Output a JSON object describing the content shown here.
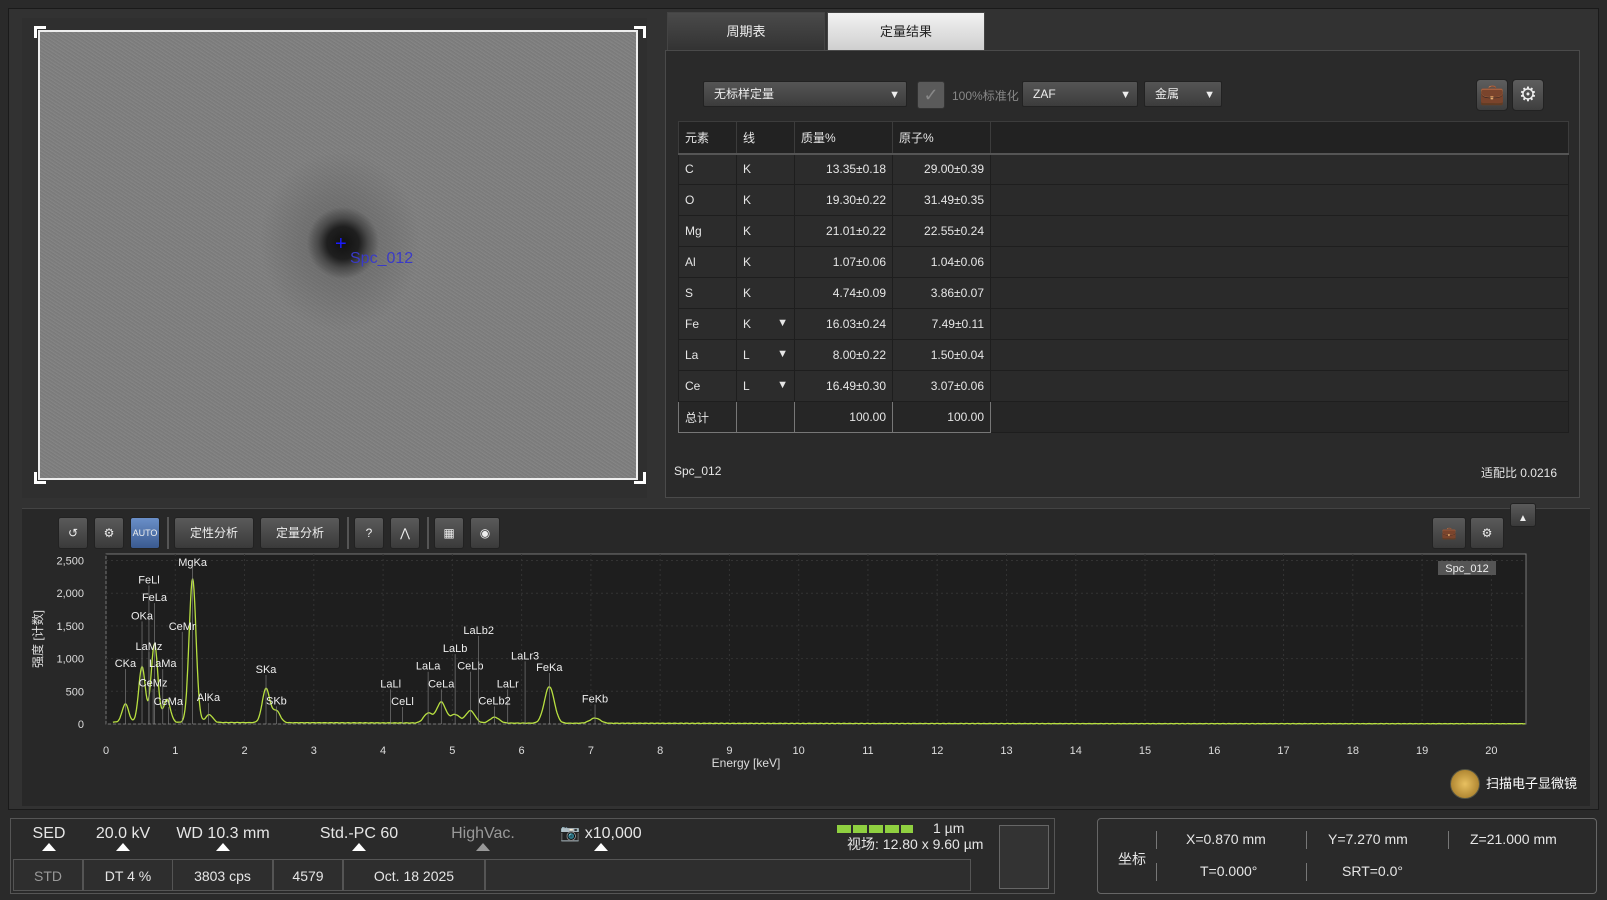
{
  "image": {
    "spot_label": "Spc_012"
  },
  "tabs": [
    "周期表",
    "定量结果"
  ],
  "quant": {
    "method": "无标样定量",
    "normalize_label": "100%标准化",
    "correction": "ZAF",
    "material": "金属",
    "columns": [
      "元素",
      "线",
      "质量%",
      "原子%"
    ],
    "rows": [
      {
        "el": "C",
        "line": "K",
        "mass": "13.35±0.18",
        "atom": "29.00±0.39",
        "dropdown": false
      },
      {
        "el": "O",
        "line": "K",
        "mass": "19.30±0.22",
        "atom": "31.49±0.35",
        "dropdown": false
      },
      {
        "el": "Mg",
        "line": "K",
        "mass": "21.01±0.22",
        "atom": "22.55±0.24",
        "dropdown": false
      },
      {
        "el": "Al",
        "line": "K",
        "mass": "1.07±0.06",
        "atom": "1.04±0.06",
        "dropdown": false
      },
      {
        "el": "S",
        "line": "K",
        "mass": "4.74±0.09",
        "atom": "3.86±0.07",
        "dropdown": false
      },
      {
        "el": "Fe",
        "line": "K",
        "mass": "16.03±0.24",
        "atom": "7.49±0.11",
        "dropdown": true
      },
      {
        "el": "La",
        "line": "L",
        "mass": "8.00±0.22",
        "atom": "1.50±0.04",
        "dropdown": true
      },
      {
        "el": "Ce",
        "line": "L",
        "mass": "16.49±0.30",
        "atom": "3.07±0.06",
        "dropdown": true
      }
    ],
    "total": {
      "label": "总计",
      "mass": "100.00",
      "atom": "100.00"
    },
    "spectrum_name": "Spc_012",
    "fit_ratio": "适配比 0.0216"
  },
  "toolbar": {
    "qual_label": "定性分析",
    "quant_label": "定量分析",
    "auto_label": "AUTO"
  },
  "chart_data": {
    "type": "line",
    "xlabel": "Energy [keV]",
    "ylabel": "强度 [计数]",
    "xlim": [
      0,
      20.5
    ],
    "ylim": [
      0,
      2600
    ],
    "xticks": [
      0,
      1,
      2,
      3,
      4,
      5,
      6,
      7,
      8,
      9,
      10,
      11,
      12,
      13,
      14,
      15,
      16,
      17,
      18,
      19,
      20
    ],
    "yticks": [
      0,
      500,
      1000,
      1500,
      2000,
      2500
    ],
    "ytick_labels": [
      "0",
      "500",
      "1,000",
      "1,500",
      "2,000",
      "2,500"
    ],
    "legend": "Spc_012",
    "peaks": [
      {
        "x": 0.28,
        "y": 280
      },
      {
        "x": 0.52,
        "y": 850
      },
      {
        "x": 0.7,
        "y": 1200
      },
      {
        "x": 0.88,
        "y": 350
      },
      {
        "x": 1.25,
        "y": 2200
      },
      {
        "x": 1.49,
        "y": 120
      },
      {
        "x": 2.31,
        "y": 520
      },
      {
        "x": 2.46,
        "y": 180
      },
      {
        "x": 4.65,
        "y": 150
      },
      {
        "x": 4.84,
        "y": 320
      },
      {
        "x": 5.04,
        "y": 130
      },
      {
        "x": 5.26,
        "y": 190
      },
      {
        "x": 5.61,
        "y": 90
      },
      {
        "x": 6.4,
        "y": 560
      },
      {
        "x": 7.06,
        "y": 80
      }
    ],
    "annotations": [
      {
        "text": "MgKa",
        "x": 1.25,
        "y": 2420
      },
      {
        "text": "FeLl",
        "x": 0.62,
        "y": 2150
      },
      {
        "text": "FeLa",
        "x": 0.7,
        "y": 1880
      },
      {
        "text": "OKa",
        "x": 0.52,
        "y": 1600
      },
      {
        "text": "CeMr",
        "x": 1.1,
        "y": 1440
      },
      {
        "text": "LaMz",
        "x": 0.62,
        "y": 1130
      },
      {
        "text": "CKa",
        "x": 0.28,
        "y": 870
      },
      {
        "text": "LaMa",
        "x": 0.82,
        "y": 870
      },
      {
        "text": "CeMz",
        "x": 0.68,
        "y": 570
      },
      {
        "text": "CeMa",
        "x": 0.9,
        "y": 290
      },
      {
        "text": "AlKa",
        "x": 1.48,
        "y": 350
      },
      {
        "text": "SKa",
        "x": 2.31,
        "y": 780
      },
      {
        "text": "SKb",
        "x": 2.46,
        "y": 300
      },
      {
        "text": "LaLl",
        "x": 4.11,
        "y": 560
      },
      {
        "text": "CeLl",
        "x": 4.28,
        "y": 290
      },
      {
        "text": "LaLa",
        "x": 4.65,
        "y": 830
      },
      {
        "text": "CeLa",
        "x": 4.84,
        "y": 560
      },
      {
        "text": "LaLb",
        "x": 5.04,
        "y": 1100
      },
      {
        "text": "CeLb",
        "x": 5.26,
        "y": 830
      },
      {
        "text": "LaLb2",
        "x": 5.38,
        "y": 1380
      },
      {
        "text": "LaLr3",
        "x": 6.05,
        "y": 990
      },
      {
        "text": "LaLr",
        "x": 5.8,
        "y": 560
      },
      {
        "text": "CeLb2",
        "x": 5.61,
        "y": 300
      },
      {
        "text": "FeKa",
        "x": 6.4,
        "y": 810
      },
      {
        "text": "FeKb",
        "x": 7.06,
        "y": 330
      }
    ]
  },
  "scope_button": "扫描电子显微镜",
  "status": {
    "detector": "SED",
    "kv": "20.0 kV",
    "wd": "WD 10.3 mm",
    "probe": "Std.-PC 60",
    "vac": "HighVac.",
    "mag": "x10,000",
    "scale": "1 µm",
    "fov": "视场: 12.80 x 9.60 µm",
    "mode": "STD",
    "dt": "DT 4 %",
    "cps": "3803 cps",
    "counts": "4579",
    "date": "Oct. 18 2025"
  },
  "coords": {
    "label": "坐标",
    "x": "X=0.870 mm",
    "y": "Y=7.270 mm",
    "z": "Z=21.000 mm",
    "t": "T=0.000°",
    "srt": "SRT=0.0°"
  }
}
